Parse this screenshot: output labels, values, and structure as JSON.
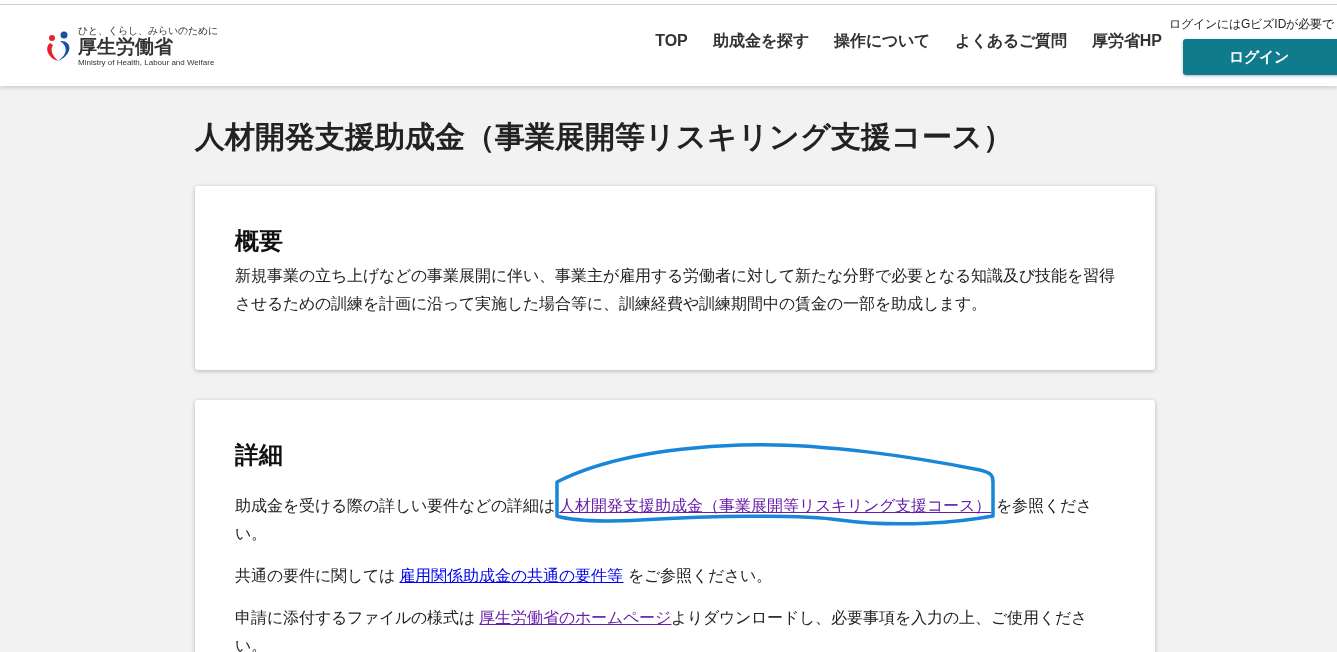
{
  "header": {
    "logo": {
      "tagline": "ひと、くらし、みらいのために",
      "name": "厚生労働省",
      "english": "Ministry of Health, Labour and Welfare"
    },
    "nav": [
      {
        "label": "TOP"
      },
      {
        "label": "助成金を探す"
      },
      {
        "label": "操作について"
      },
      {
        "label": "よくあるご質問"
      },
      {
        "label": "厚労省HP"
      }
    ],
    "login_note": "ログインにはGビズIDが必要で",
    "login_button": "ログイン"
  },
  "page_title": "人材開発支援助成金（事業展開等リスキリング支援コース）",
  "sections": [
    {
      "heading": "概要",
      "paragraphs": [
        [
          {
            "kind": "text",
            "text": "新規事業の立ち上げなどの事業展開に伴い、事業主が雇用する労働者に対して新たな分野で必要となる知識及び技能を習得させるための訓練を計画に沿って実施した場合等に、訓練経費や訓練期間中の賃金の一部を助成します。"
          }
        ]
      ]
    },
    {
      "heading": "詳細",
      "paragraphs": [
        [
          {
            "kind": "text",
            "text": "助成金を受ける際の詳しい要件などの詳細は "
          },
          {
            "kind": "link",
            "text": "人材開発支援助成金（事業展開等リスキリング支援コース）",
            "visited": true
          },
          {
            "kind": "text",
            "text": " を参照ください。"
          }
        ],
        [
          {
            "kind": "text",
            "text": "共通の要件に関しては "
          },
          {
            "kind": "link",
            "text": "雇用関係助成金の共通の要件等",
            "visited": false
          },
          {
            "kind": "text",
            "text": " をご参照ください。"
          }
        ],
        [
          {
            "kind": "text",
            "text": "申請に添付するファイルの様式は "
          },
          {
            "kind": "link",
            "text": "厚生労働省のホームページ",
            "visited": true
          },
          {
            "kind": "text",
            "text": "よりダウンロードし、必要事項を入力の上、ご使用ください。"
          }
        ]
      ]
    }
  ]
}
